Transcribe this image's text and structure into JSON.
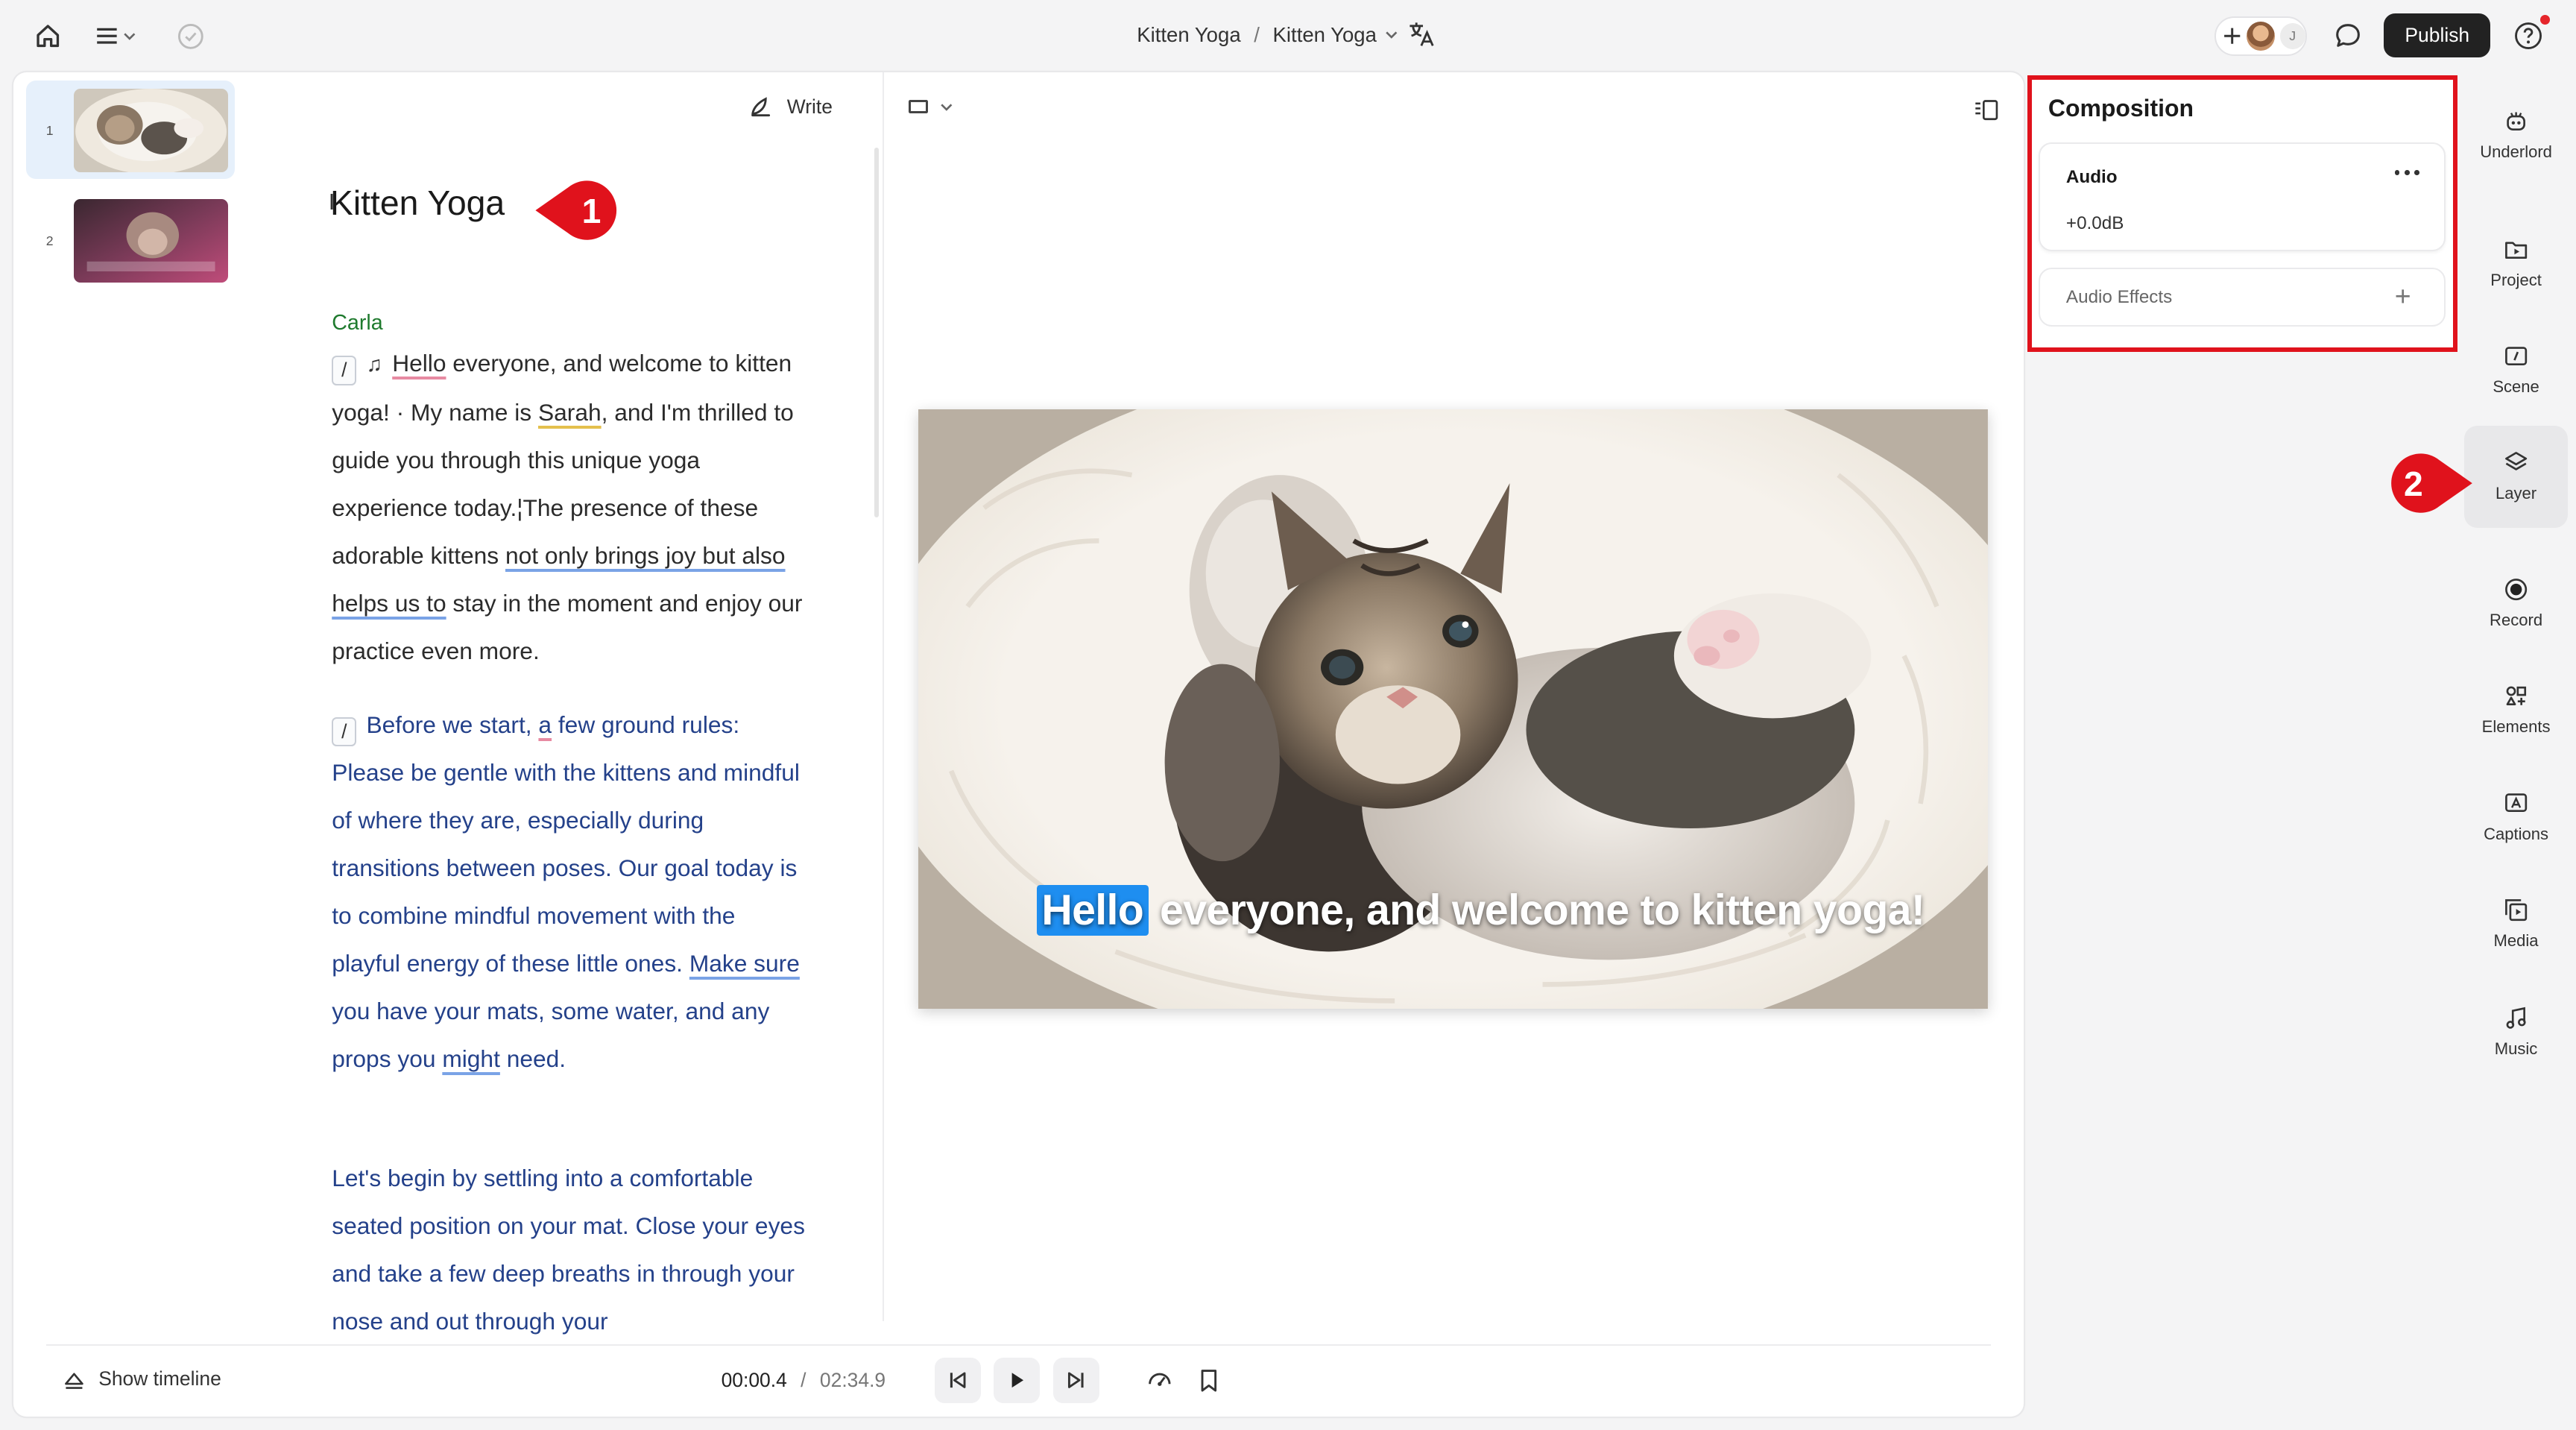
{
  "topbar": {
    "breadcrumb": [
      "Kitten Yoga",
      "Kitten Yoga"
    ],
    "breadcrumb_separator": "/",
    "collaborator_initial": "J",
    "publish_label": "Publish",
    "icons": [
      "home-icon",
      "menu-icon",
      "sync-status-icon",
      "chevron-down-icon",
      "translate-icon",
      "add-collaborator-icon",
      "comment-icon",
      "help-icon",
      "notification-dot"
    ],
    "notification_color": "#e5252b"
  },
  "scenes": [
    {
      "number": "1",
      "active": true
    },
    {
      "number": "2",
      "active": false,
      "thumb_caption": "Before we start, a few ground rules: Please be"
    }
  ],
  "script": {
    "write_label": "Write",
    "title": "Kitten Yoga",
    "speaker": "Carla",
    "speaker_color": "#1f7a2e",
    "paragraph1": {
      "t1": "Hello",
      "t2": " everyone, and welcome to kitten yoga! · My name is ",
      "t3": "Sarah",
      "t4": ", and I'm thrilled to guide you through this unique yoga experience today.¦The presence of these adorable kittens ",
      "t5": "not only brings joy but also helps us to",
      "t6": " stay in the moment and enjoy our practice even more."
    },
    "paragraph2": {
      "t1": "Before we start",
      "t2": ", ",
      "t3": "a",
      "t4": " few ground rules: Please be gentle with the kittens and mindful of where they are, especially during transitions between poses. Our goal today is to combine mindful movement with the playful energy of these little ones. ",
      "t5": "Make sure",
      "t6": " you have your mats, some water, and any props you ",
      "t7": "might",
      "t8": " need."
    },
    "paragraph3": "Let's begin by settling into a comfortable seated position on your mat. Close your eyes and take a few deep breaths in through your nose and out through your",
    "slash_glyph": "/",
    "music_glyph": "♫",
    "text_color_selected": "#24418a"
  },
  "preview": {
    "caption_highlight": "Hello",
    "caption_rest": " everyone, and welcome to kitten yoga!",
    "highlight_color": "#1e8ef0"
  },
  "transport": {
    "show_timeline_label": "Show timeline",
    "current_time": "00:00.4",
    "separator": "/",
    "duration": "02:34.9"
  },
  "composition": {
    "title": "Composition",
    "audio_label": "Audio",
    "audio_gain": "+0.0dB",
    "effects_label": "Audio Effects",
    "highlight_border_color": "#e0121c"
  },
  "rail": [
    {
      "label": "Underlord",
      "icon": "underlord-icon"
    },
    {
      "label": "Project",
      "icon": "project-icon"
    },
    {
      "label": "Scene",
      "icon": "scene-icon"
    },
    {
      "label": "Layer",
      "icon": "layers-icon",
      "active": true
    },
    {
      "label": "Record",
      "icon": "record-icon"
    },
    {
      "label": "Elements",
      "icon": "elements-icon"
    },
    {
      "label": "Captions",
      "icon": "captions-icon"
    },
    {
      "label": "Media",
      "icon": "media-icon"
    },
    {
      "label": "Music",
      "icon": "music-icon"
    }
  ],
  "annotations": [
    {
      "label": "1",
      "color": "#e0121c"
    },
    {
      "label": "2",
      "color": "#e0121c"
    }
  ]
}
